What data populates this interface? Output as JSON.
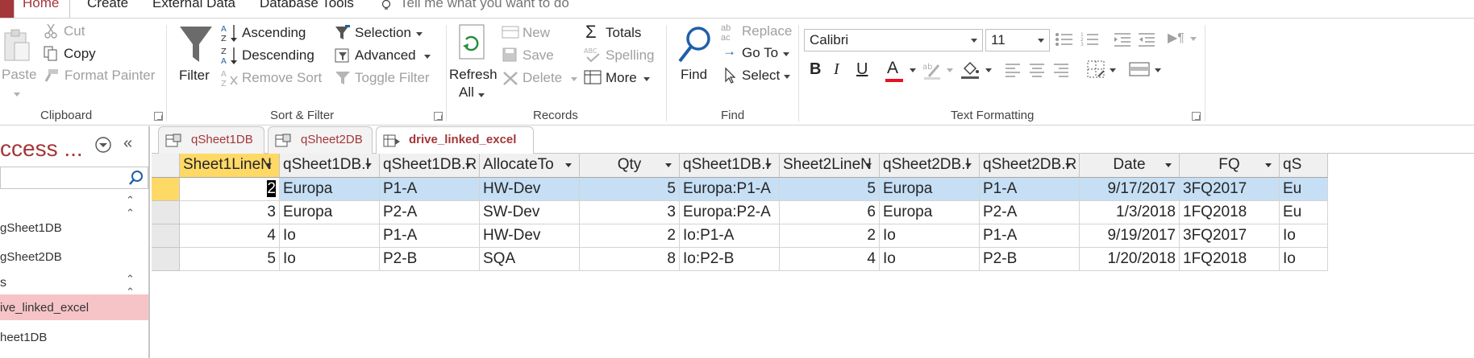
{
  "tabs": {
    "home": "Home",
    "create": "Create",
    "external_data": "External Data",
    "database_tools": "Database Tools",
    "tell_me": "Tell me what you want to do"
  },
  "clipboard": {
    "paste": "Paste",
    "cut": "Cut",
    "copy": "Copy",
    "format_painter": "Format Painter",
    "label": "Clipboard"
  },
  "sort_filter": {
    "filter": "Filter",
    "ascending": "Ascending",
    "descending": "Descending",
    "remove_sort": "Remove Sort",
    "selection": "Selection",
    "advanced": "Advanced",
    "toggle_filter": "Toggle Filter",
    "label": "Sort & Filter"
  },
  "records": {
    "refresh_1": "Refresh",
    "refresh_2": "All",
    "new": "New",
    "save": "Save",
    "delete": "Delete",
    "totals": "Totals",
    "spelling": "Spelling",
    "more": "More",
    "label": "Records"
  },
  "find": {
    "find": "Find",
    "replace": "Replace",
    "goto": "Go To",
    "select": "Select",
    "label": "Find"
  },
  "text_formatting": {
    "font": "Calibri",
    "size": "11",
    "bold": "B",
    "italic": "I",
    "underline": "U",
    "font_color_letter": "A",
    "label": "Text Formatting"
  },
  "nav": {
    "title": "ccess ...",
    "items": [
      "gSheet1DB",
      "gSheet2DB",
      "ive_linked_excel",
      "heet1DB"
    ],
    "group_s": "s"
  },
  "doctabs": [
    "qSheet1DB",
    "qSheet2DB",
    "drive_linked_excel"
  ],
  "grid": {
    "columns": [
      "Sheet1LineN",
      "qSheet1DB.I",
      "qSheet1DB.R",
      "AllocateTo",
      "Qty",
      "qSheet1DB.I",
      "Sheet2LineN",
      "qSheet2DB.I",
      "qSheet2DB.R",
      "Date",
      "FQ",
      "qS"
    ],
    "rows": [
      [
        "2",
        "Europa",
        "P1-A",
        "HW-Dev",
        "5",
        "Europa:P1-A",
        "5",
        "Europa",
        "P1-A",
        "9/17/2017",
        "3FQ2017",
        "Eu"
      ],
      [
        "3",
        "Europa",
        "P2-A",
        "SW-Dev",
        "3",
        "Europa:P2-A",
        "6",
        "Europa",
        "P2-A",
        "1/3/2018",
        "1FQ2018",
        "Eu"
      ],
      [
        "4",
        "Io",
        "P1-A",
        "HW-Dev",
        "2",
        "Io:P1-A",
        "2",
        "Io",
        "P1-A",
        "9/19/2017",
        "3FQ2017",
        "Io"
      ],
      [
        "5",
        "Io",
        "P2-B",
        "SQA",
        "8",
        "Io:P2-B",
        "4",
        "Io",
        "P2-B",
        "1/20/2018",
        "1FQ2018",
        "Io"
      ]
    ]
  },
  "colors": {
    "accent": "#a4373a",
    "selected_row": "#c6dff5",
    "first_header": "#ffd966",
    "nav_selected": "#f6c4c6"
  }
}
